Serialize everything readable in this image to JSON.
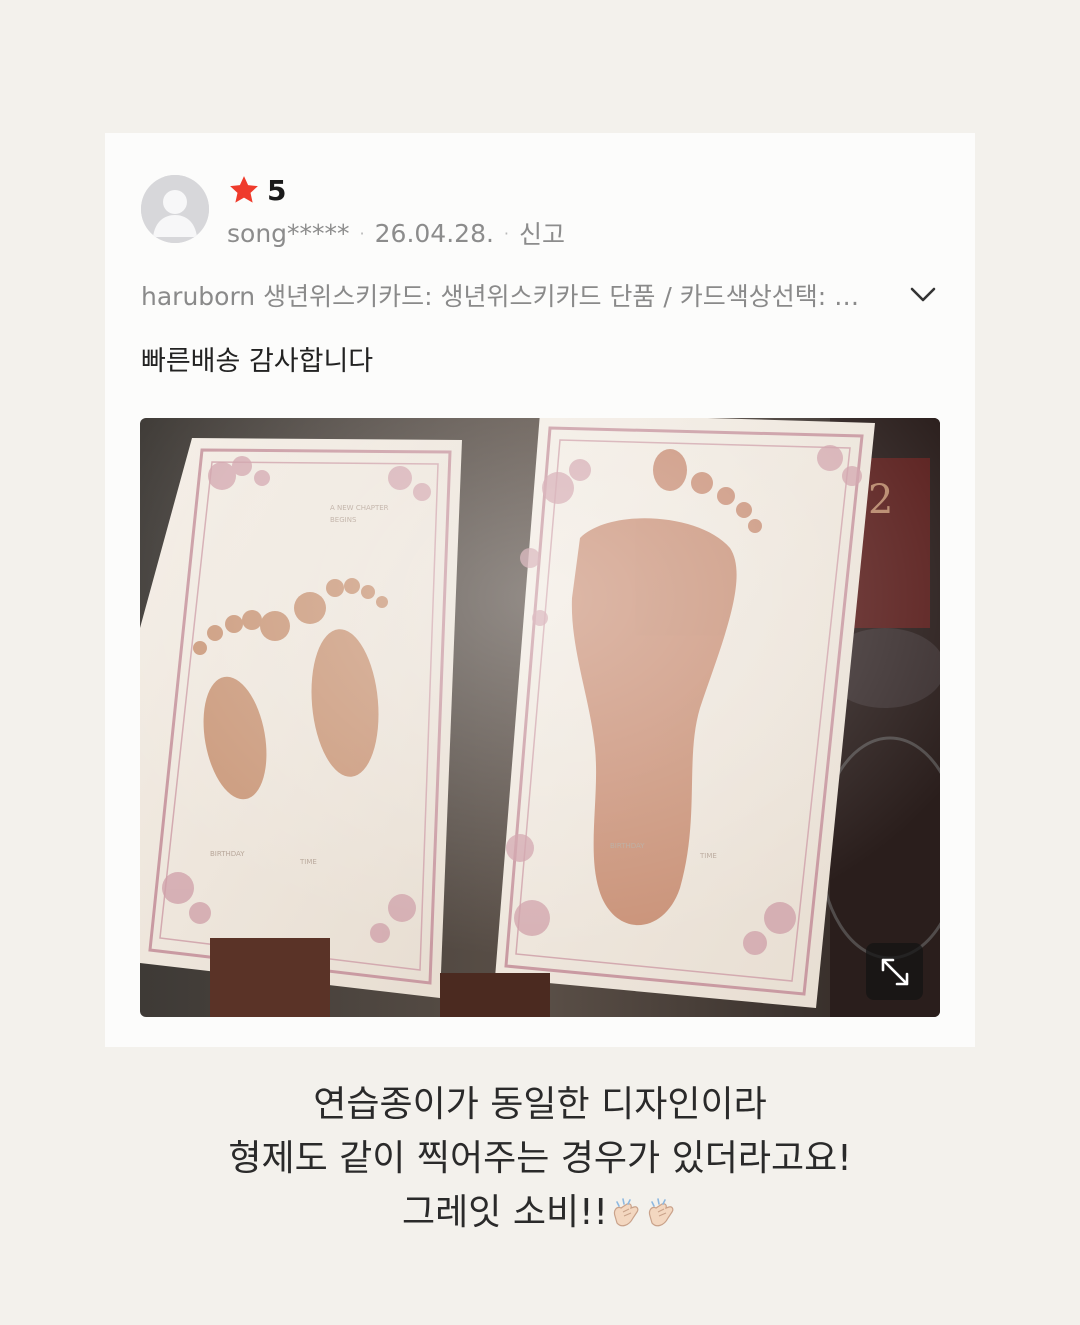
{
  "review": {
    "rating": "5",
    "user": "song*****",
    "date": "26.04.28.",
    "report_label": "신고",
    "option": "haruborn 생년위스키카드: 생년위스키카드 단품 / 카드색상선택: 적(…",
    "text": "빠른배송 감사합니다"
  },
  "caption": {
    "line1": "연습종이가 동일한 디자인이라",
    "line2": "형제도 같이 찍어주는 경우가 있더라고요!",
    "line3": "그레잇 소비!!"
  },
  "colors": {
    "background": "#f3f1ec",
    "card": "#fcfcfb",
    "star": "#ef3b2c",
    "muted_text": "#8c8c8c"
  },
  "icons": [
    "avatar-icon",
    "star-icon",
    "chevron-down-icon",
    "expand-icon",
    "clapping-hands-icon"
  ]
}
